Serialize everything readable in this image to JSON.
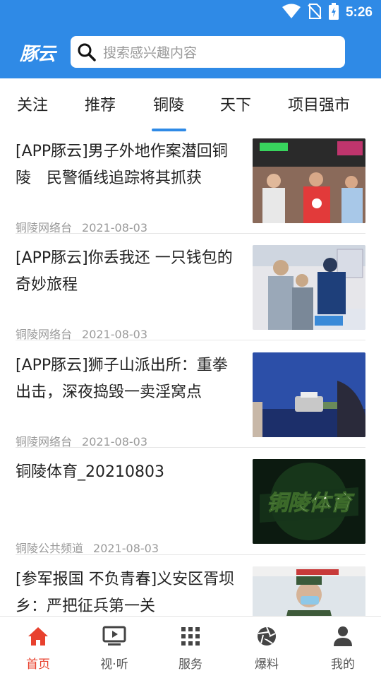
{
  "status_bar": {
    "time": "5:26",
    "icons": [
      "wifi-icon",
      "no-sim-icon",
      "battery-icon"
    ]
  },
  "header": {
    "logo_text": "豚云",
    "search_placeholder": "搜索感兴趣内容",
    "colors": {
      "primary": "#2f8ae6"
    }
  },
  "tabs": [
    {
      "label": "关注",
      "active": false
    },
    {
      "label": "推荐",
      "active": false
    },
    {
      "label": "铜陵",
      "active": true
    },
    {
      "label": "天下",
      "active": false
    },
    {
      "label": "项目强市",
      "active": false
    }
  ],
  "feed": [
    {
      "title": "[APP豚云]男子外地作案潜回铜陵　民警循线追踪将其抓获",
      "source": "铜陵网络台",
      "date": "2021-08-03",
      "image_desc": "police-arrest-photo"
    },
    {
      "title": "[APP豚云]你丢我还 一只钱包的奇妙旅程",
      "source": "铜陵网络台",
      "date": "2021-08-03",
      "image_desc": "police-office-photo"
    },
    {
      "title": "[APP豚云]狮子山派出所：重拳出击，深夜捣毁一卖淫窝点",
      "source": "铜陵网络台",
      "date": "2021-08-03",
      "image_desc": "counting-money-photo"
    },
    {
      "title": "铜陵体育_20210803",
      "source": "铜陵公共频道",
      "date": "2021-08-03",
      "image_desc": "tongling-sports-logo",
      "image_text": "铜陵体育"
    },
    {
      "title": "[参军报国 不负青春]义安区胥坝乡：严把征兵第一关",
      "source": "",
      "date": "",
      "image_desc": "military-officer-photo"
    }
  ],
  "bottom_nav": [
    {
      "label": "首页",
      "icon": "home-icon",
      "active": true
    },
    {
      "label": "视·听",
      "icon": "tv-play-icon",
      "active": false
    },
    {
      "label": "服务",
      "icon": "grid-icon",
      "active": false
    },
    {
      "label": "爆料",
      "icon": "camera-aperture-icon",
      "active": false
    },
    {
      "label": "我的",
      "icon": "person-icon",
      "active": false
    }
  ],
  "colors": {
    "accent_active": "#e8412e",
    "text_primary": "#222222",
    "text_meta": "#9a9a9a"
  }
}
